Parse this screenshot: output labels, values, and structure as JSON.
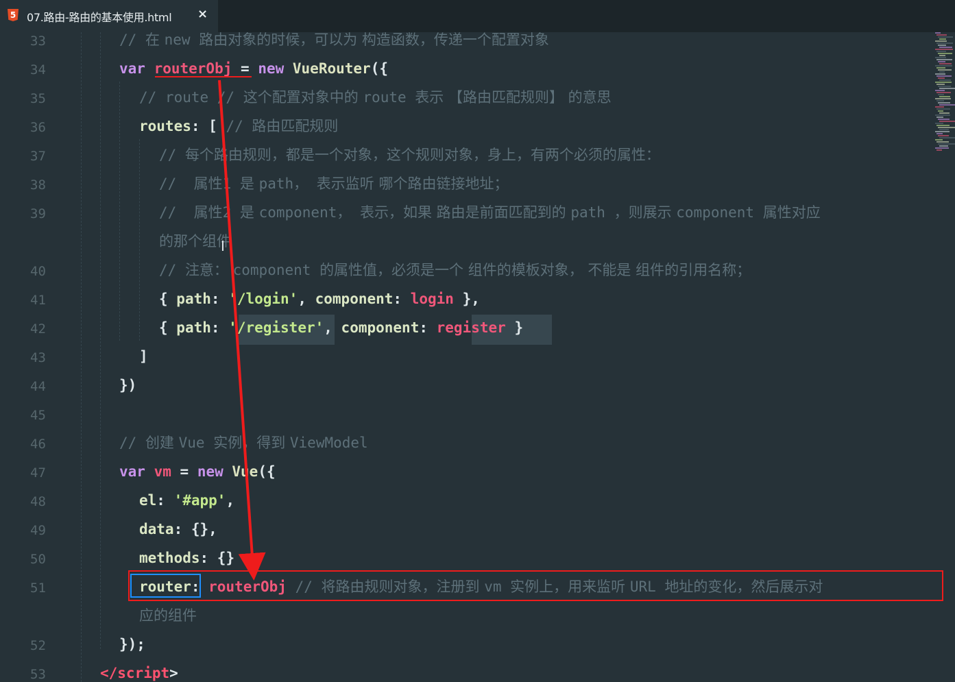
{
  "tab": {
    "icon": "html5-icon",
    "title": "07.路由-路由的基本使用.html",
    "close": "×"
  },
  "lines": [
    {
      "n": "33",
      "parts": [
        [
          "cm",
          "// "
        ],
        [
          "cmz",
          "在 "
        ],
        [
          "cm",
          "new "
        ],
        [
          "cmz",
          "路由对象的时候，可以为 构造函数，传递一个配置对象"
        ]
      ]
    },
    {
      "n": "34",
      "parts": [
        [
          "kw",
          "var "
        ],
        [
          "var",
          "routerObj"
        ],
        [
          "punc",
          " = "
        ],
        [
          "kw",
          "new "
        ],
        [
          "fn",
          "VueRouter"
        ],
        [
          "punc",
          "({"
        ]
      ]
    },
    {
      "n": "35",
      "parts": [
        [
          "cm",
          "// route // "
        ],
        [
          "cmz",
          "这个配置对象中的 "
        ],
        [
          "cm",
          "route "
        ],
        [
          "cmz",
          "表示 【路由匹配规则】 的意思"
        ]
      ]
    },
    {
      "n": "36",
      "parts": [
        [
          "prop",
          "routes"
        ],
        [
          "punc",
          ": [ "
        ],
        [
          "cm",
          "// "
        ],
        [
          "cmz",
          "路由匹配规则"
        ]
      ]
    },
    {
      "n": "37",
      "parts": [
        [
          "cm",
          "// "
        ],
        [
          "cmz",
          "每个路由规则，都是一个对象，这个规则对象，身上，有两个必须的属性："
        ]
      ]
    },
    {
      "n": "38",
      "parts": [
        [
          "cm",
          "//  "
        ],
        [
          "cmz",
          "属性"
        ],
        [
          "cm",
          "1 "
        ],
        [
          "cmz",
          "是 "
        ],
        [
          "cm",
          "path， "
        ],
        [
          "cmz",
          "表示监听 哪个路由链接地址；"
        ]
      ]
    },
    {
      "n": "39",
      "parts": [
        [
          "cm",
          "//  "
        ],
        [
          "cmz",
          "属性"
        ],
        [
          "cm",
          "2 "
        ],
        [
          "cmz",
          "是 "
        ],
        [
          "cm",
          "component， "
        ],
        [
          "cmz",
          "表示，如果 路由是前面匹配到的 "
        ],
        [
          "cm",
          "path "
        ],
        [
          "cmz",
          "，则展示 "
        ],
        [
          "cm",
          "component "
        ],
        [
          "cmz",
          "属性对应"
        ]
      ]
    },
    {
      "n": "",
      "parts": [
        [
          "cmz",
          "的那个组件"
        ]
      ]
    },
    {
      "n": "40",
      "parts": [
        [
          "cm",
          "// "
        ],
        [
          "cmz",
          "注意： "
        ],
        [
          "cm",
          "component "
        ],
        [
          "cmz",
          "的属性值，必须是一个 组件的模板对象， 不能是 组件的引用名称；"
        ]
      ]
    },
    {
      "n": "41",
      "parts": [
        [
          "punc",
          "{ "
        ],
        [
          "prop",
          "path"
        ],
        [
          "punc",
          ": "
        ],
        [
          "str",
          "'/login'"
        ],
        [
          "punc",
          ", "
        ],
        [
          "prop",
          "component"
        ],
        [
          "punc",
          ": "
        ],
        [
          "var",
          "login"
        ],
        [
          "punc",
          " },"
        ]
      ]
    },
    {
      "n": "42",
      "parts": [
        [
          "punc",
          "{ "
        ],
        [
          "prop",
          "path"
        ],
        [
          "punc",
          ": "
        ],
        [
          "str",
          "'/register'"
        ],
        [
          "punc",
          ", "
        ],
        [
          "prop",
          "component"
        ],
        [
          "punc",
          ": "
        ],
        [
          "var",
          "register"
        ],
        [
          "punc",
          " }"
        ]
      ]
    },
    {
      "n": "43",
      "parts": [
        [
          "punc",
          "]"
        ]
      ]
    },
    {
      "n": "44",
      "parts": [
        [
          "punc",
          "})"
        ]
      ]
    },
    {
      "n": "45",
      "parts": []
    },
    {
      "n": "46",
      "parts": [
        [
          "cm",
          "// "
        ],
        [
          "cmz",
          "创建 "
        ],
        [
          "cm",
          "Vue "
        ],
        [
          "cmz",
          "实例，得到 "
        ],
        [
          "cm",
          "ViewModel"
        ]
      ]
    },
    {
      "n": "47",
      "parts": [
        [
          "kw",
          "var "
        ],
        [
          "var",
          "vm"
        ],
        [
          "punc",
          " = "
        ],
        [
          "kw",
          "new "
        ],
        [
          "fn",
          "Vue"
        ],
        [
          "punc",
          "({"
        ]
      ]
    },
    {
      "n": "48",
      "parts": [
        [
          "prop",
          "el"
        ],
        [
          "punc",
          ": "
        ],
        [
          "str",
          "'#app'"
        ],
        [
          "punc",
          ","
        ]
      ]
    },
    {
      "n": "49",
      "parts": [
        [
          "prop",
          "data"
        ],
        [
          "punc",
          ": {},"
        ]
      ]
    },
    {
      "n": "50",
      "parts": [
        [
          "prop",
          "methods"
        ],
        [
          "punc",
          ": {}"
        ]
      ]
    },
    {
      "n": "51",
      "parts": [
        [
          "prop",
          "router"
        ],
        [
          "punc",
          ": "
        ],
        [
          "var",
          "routerObj"
        ],
        [
          "punc",
          " "
        ],
        [
          "cm",
          "// "
        ],
        [
          "cmz",
          "将路由规则对象，注册到 "
        ],
        [
          "cm",
          "vm "
        ],
        [
          "cmz",
          "实例上，用来监听 "
        ],
        [
          "cm",
          "URL "
        ],
        [
          "cmz",
          "地址的变化，然后展示对"
        ]
      ]
    },
    {
      "n": "",
      "parts": [
        [
          "cmz",
          "应的组件"
        ]
      ]
    },
    {
      "n": "52",
      "parts": [
        [
          "punc",
          "});"
        ]
      ]
    },
    {
      "n": "53",
      "parts": [
        [
          "tag",
          "</script"
        ],
        [
          "punc",
          ">"
        ]
      ]
    }
  ]
}
